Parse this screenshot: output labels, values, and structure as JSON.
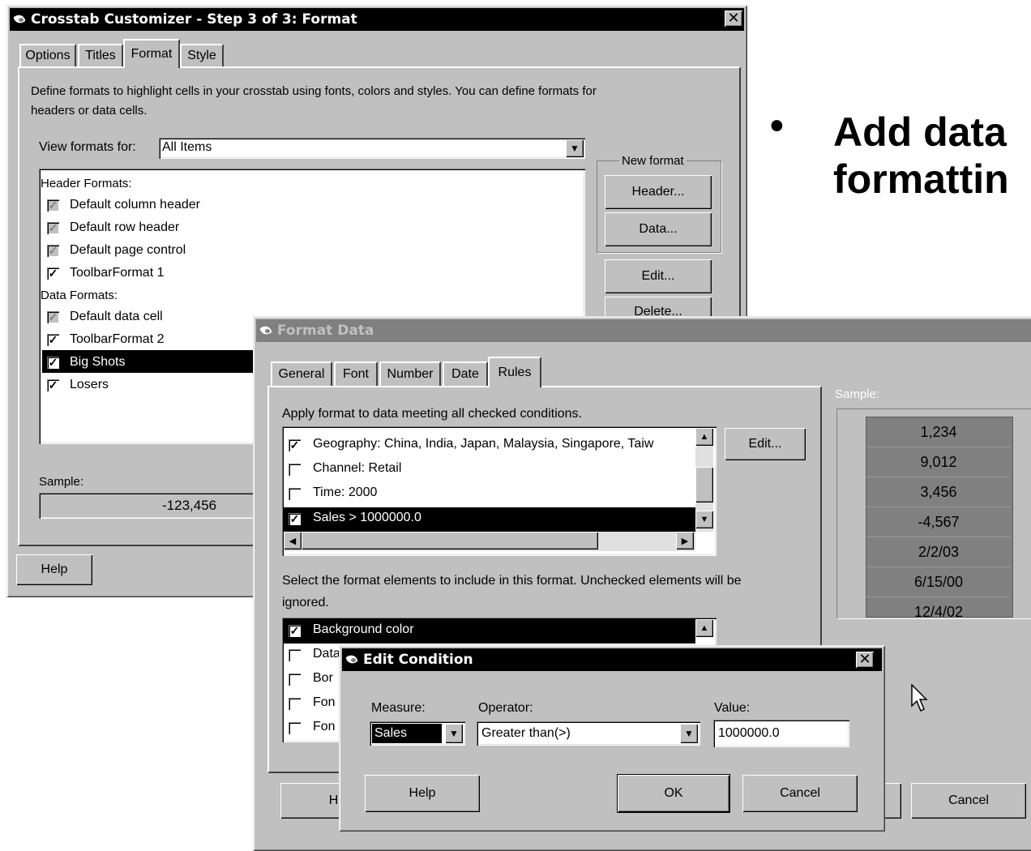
{
  "crosstab": {
    "title": "Crosstab Customizer - Step 3 of 3: Format",
    "tabs": [
      "Options",
      "Titles",
      "Format",
      "Style"
    ],
    "description_line1": "Define formats to highlight cells in your crosstab using fonts, colors and styles. You can define formats for",
    "description_line2": "headers or data cells.",
    "view_label": "View formats for:",
    "view_value": "All Items",
    "header_section": "Header Formats:",
    "header_items": [
      {
        "label": "Default column header",
        "state": "gray"
      },
      {
        "label": "Default row header",
        "state": "gray"
      },
      {
        "label": "Default page control",
        "state": "gray"
      },
      {
        "label": "ToolbarFormat 1",
        "state": "checked"
      }
    ],
    "data_section": "Data Formats:",
    "data_items": [
      {
        "label": "Default data cell",
        "state": "gray"
      },
      {
        "label": "ToolbarFormat 2",
        "state": "checked"
      },
      {
        "label": "Big Shots",
        "state": "checked",
        "selected": true
      },
      {
        "label": "Losers",
        "state": "checked"
      }
    ],
    "new_format_group": "New format",
    "header_btn": "Header...",
    "data_btn": "Data...",
    "edit_btn": "Edit...",
    "delete_btn": "Delete...",
    "sample_label": "Sample:",
    "sample_value": "-123,456",
    "help_btn": "Help"
  },
  "slide": {
    "bullet": "•",
    "line1": "Add data",
    "line2": "formattin"
  },
  "format_data": {
    "title": "Format Data",
    "tabs": [
      "General",
      "Font",
      "Number",
      "Date",
      "Rules"
    ],
    "apply_text": "Apply format to data meeting all checked conditions.",
    "conditions": [
      {
        "label": "Geography: China, India, Japan, Malaysia, Singapore, Taiw",
        "checked": true
      },
      {
        "label": "Channel: Retail",
        "checked": false
      },
      {
        "label": "Time: 2000",
        "checked": false
      },
      {
        "label": "Sales > 1000000.0",
        "checked": true,
        "selected": true
      }
    ],
    "edit_btn": "Edit...",
    "select_text_line1": "Select the format elements to include in this format. Unchecked elements will be",
    "select_text_line2": "ignored.",
    "elements": [
      {
        "label": "Background color",
        "checked": true,
        "selected": true
      },
      {
        "label": "Data",
        "checked": false
      },
      {
        "label": "Bor",
        "checked": false
      },
      {
        "label": "Fon",
        "checked": false
      },
      {
        "label": "Fon",
        "checked": false
      }
    ],
    "sample_label": "Sample:",
    "sample_values": [
      "1,234",
      "9,012",
      "3,456",
      "-4,567",
      "2/2/03",
      "6/15/00",
      "12/4/02"
    ],
    "help_btn": "He",
    "cancel_btn": "Cancel"
  },
  "edit_condition": {
    "title": "Edit Condition",
    "measure_label": "Measure:",
    "measure_value": "Sales",
    "operator_label": "Operator:",
    "operator_value": "Greater than(>)",
    "value_label": "Value:",
    "value_value": "1000000.0",
    "help_btn": "Help",
    "ok_btn": "OK",
    "cancel_btn": "Cancel"
  },
  "colors": {
    "dialog_face": "#c0c0c0",
    "active_title": "#000000",
    "inactive_title": "#808080",
    "sample_cell": "#808080"
  }
}
